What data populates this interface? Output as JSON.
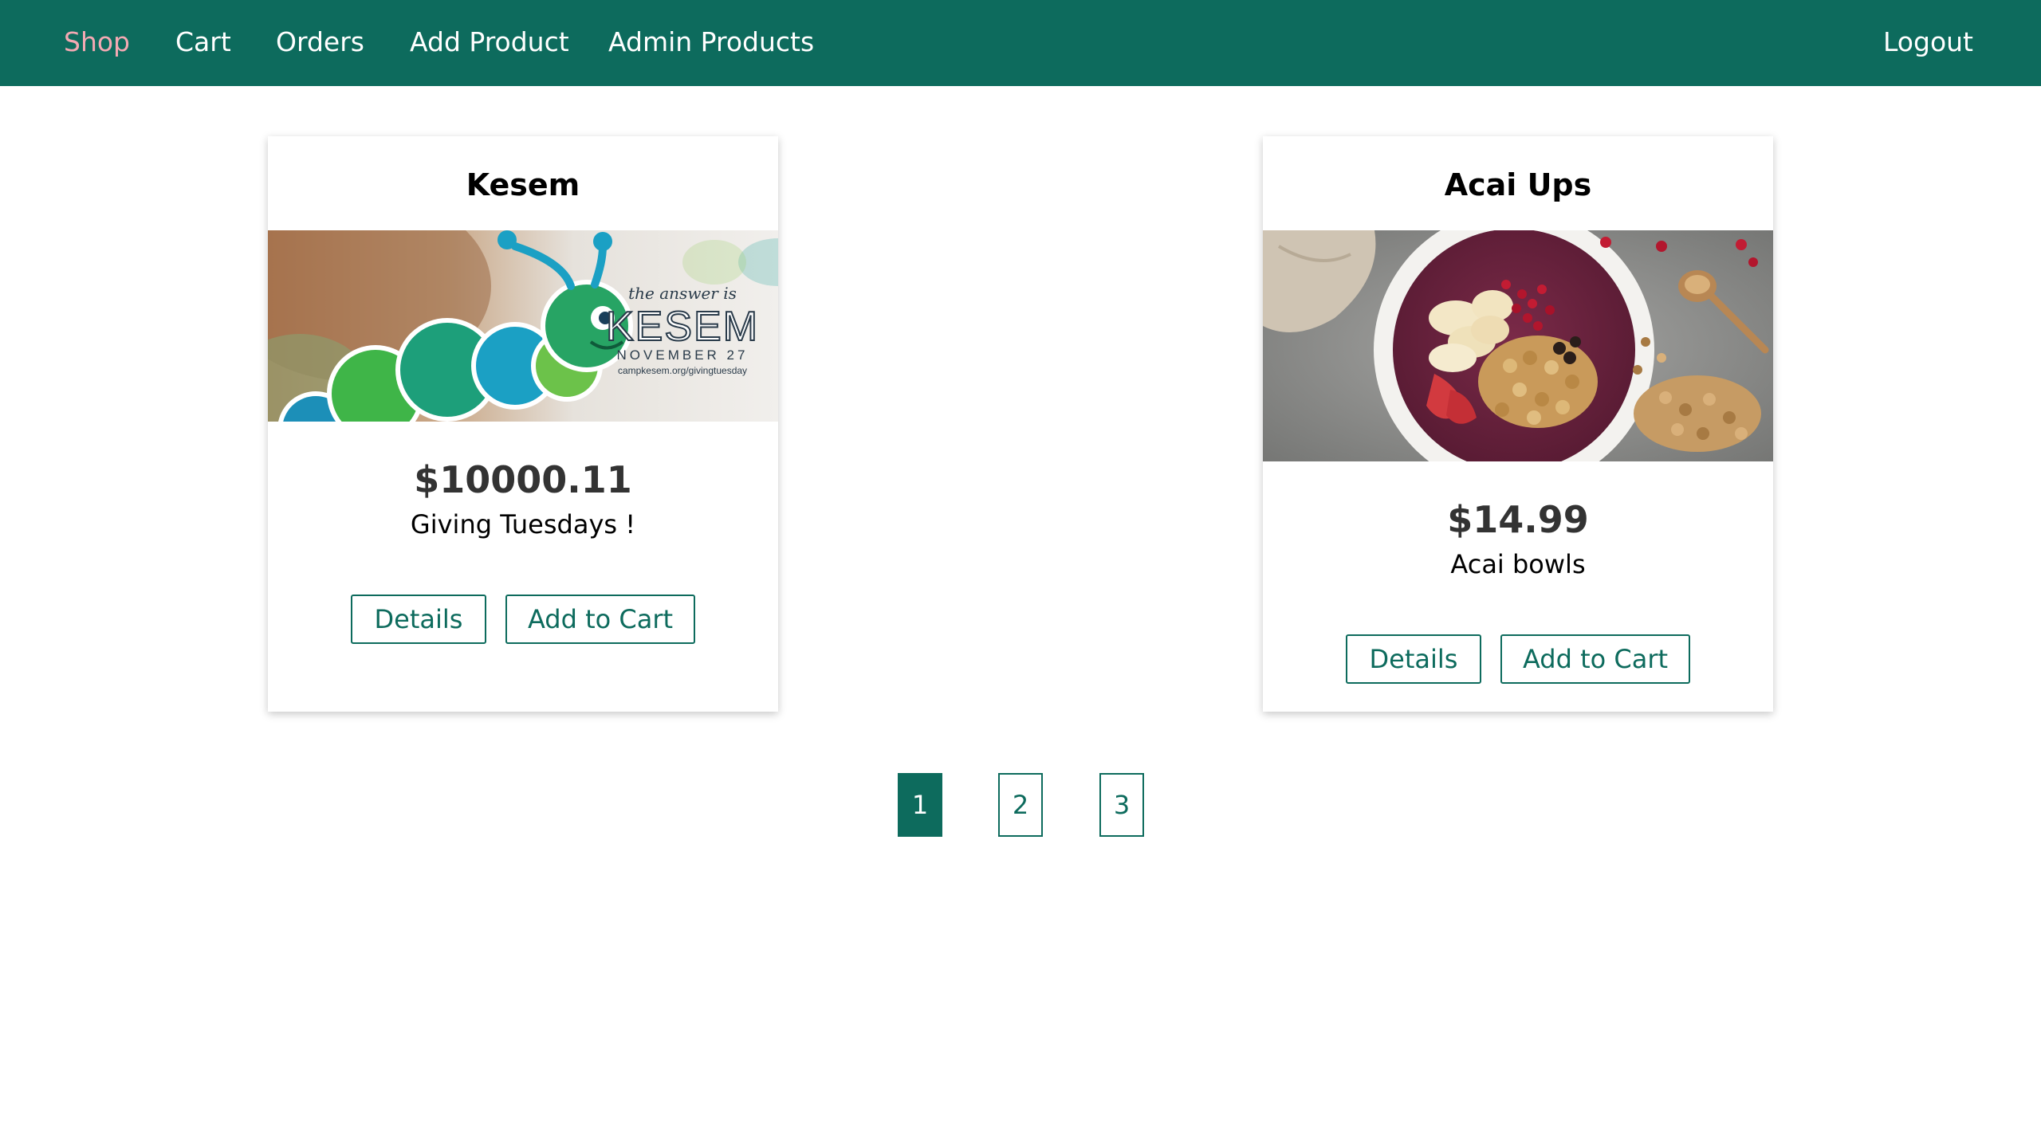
{
  "nav": {
    "links": [
      {
        "label": "Shop",
        "active": true
      },
      {
        "label": "Cart",
        "active": false
      },
      {
        "label": "Orders",
        "active": false
      },
      {
        "label": "Add Product",
        "active": false
      },
      {
        "label": "Admin Products",
        "active": false
      }
    ],
    "logout_label": "Logout"
  },
  "products": [
    {
      "title": "Kesem",
      "image": {
        "subject": "caterpillar-fundraiser-graphic",
        "lines": [
          "the answer is",
          "KESEM",
          "NOVEMBER 27",
          "campkesem.org/givingtuesday"
        ]
      },
      "price": "$10000.11",
      "description": "Giving Tuesdays !",
      "details_label": "Details",
      "add_to_cart_label": "Add to Cart"
    },
    {
      "title": "Acai Ups",
      "image": {
        "subject": "acai-bowl-photo"
      },
      "price": "$14.99",
      "description": "Acai bowls",
      "details_label": "Details",
      "add_to_cart_label": "Add to Cart"
    }
  ],
  "pagination": {
    "pages": [
      "1",
      "2",
      "3"
    ],
    "current": "1"
  },
  "colors": {
    "brand": "#0d6b5d",
    "active_nav": "#f4a9b3",
    "price_text": "#333333"
  }
}
